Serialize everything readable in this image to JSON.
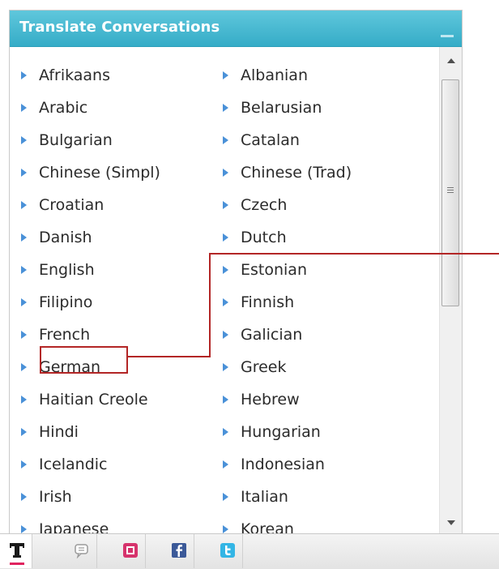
{
  "panel": {
    "title": "Translate Conversations"
  },
  "languages": {
    "left": [
      "Afrikaans",
      "Arabic",
      "Bulgarian",
      "Chinese (Simpl)",
      "Croatian",
      "Danish",
      "English",
      "Filipino",
      "French",
      "German",
      "Haitian Creole",
      "Hindi",
      "Icelandic",
      "Irish",
      "Japanese"
    ],
    "right": [
      "Albanian",
      "Belarusian",
      "Catalan",
      "Chinese (Trad)",
      "Czech",
      "Dutch",
      "Estonian",
      "Finnish",
      "Galician",
      "Greek",
      "Hebrew",
      "Hungarian",
      "Indonesian",
      "Italian",
      "Korean"
    ]
  },
  "highlighted_language": "German",
  "toolbar": {
    "items": [
      {
        "name": "translate-tool",
        "icon": "bold-T-icon",
        "active": true
      },
      {
        "name": "chat-tool",
        "icon": "chat-bubble-icon",
        "active": false
      },
      {
        "name": "pink-square-tool",
        "icon": "square-frame-icon",
        "active": false
      },
      {
        "name": "facebook-tool",
        "icon": "facebook-icon",
        "active": false
      },
      {
        "name": "twitter-tool",
        "icon": "twitter-icon",
        "active": false
      }
    ]
  },
  "colors": {
    "header": "#35acc7",
    "bullet": "#4a91d8",
    "annotation": "#b32626",
    "active_underline": "#e0235f",
    "facebook": "#3b5998",
    "twitter": "#33b5e5"
  }
}
